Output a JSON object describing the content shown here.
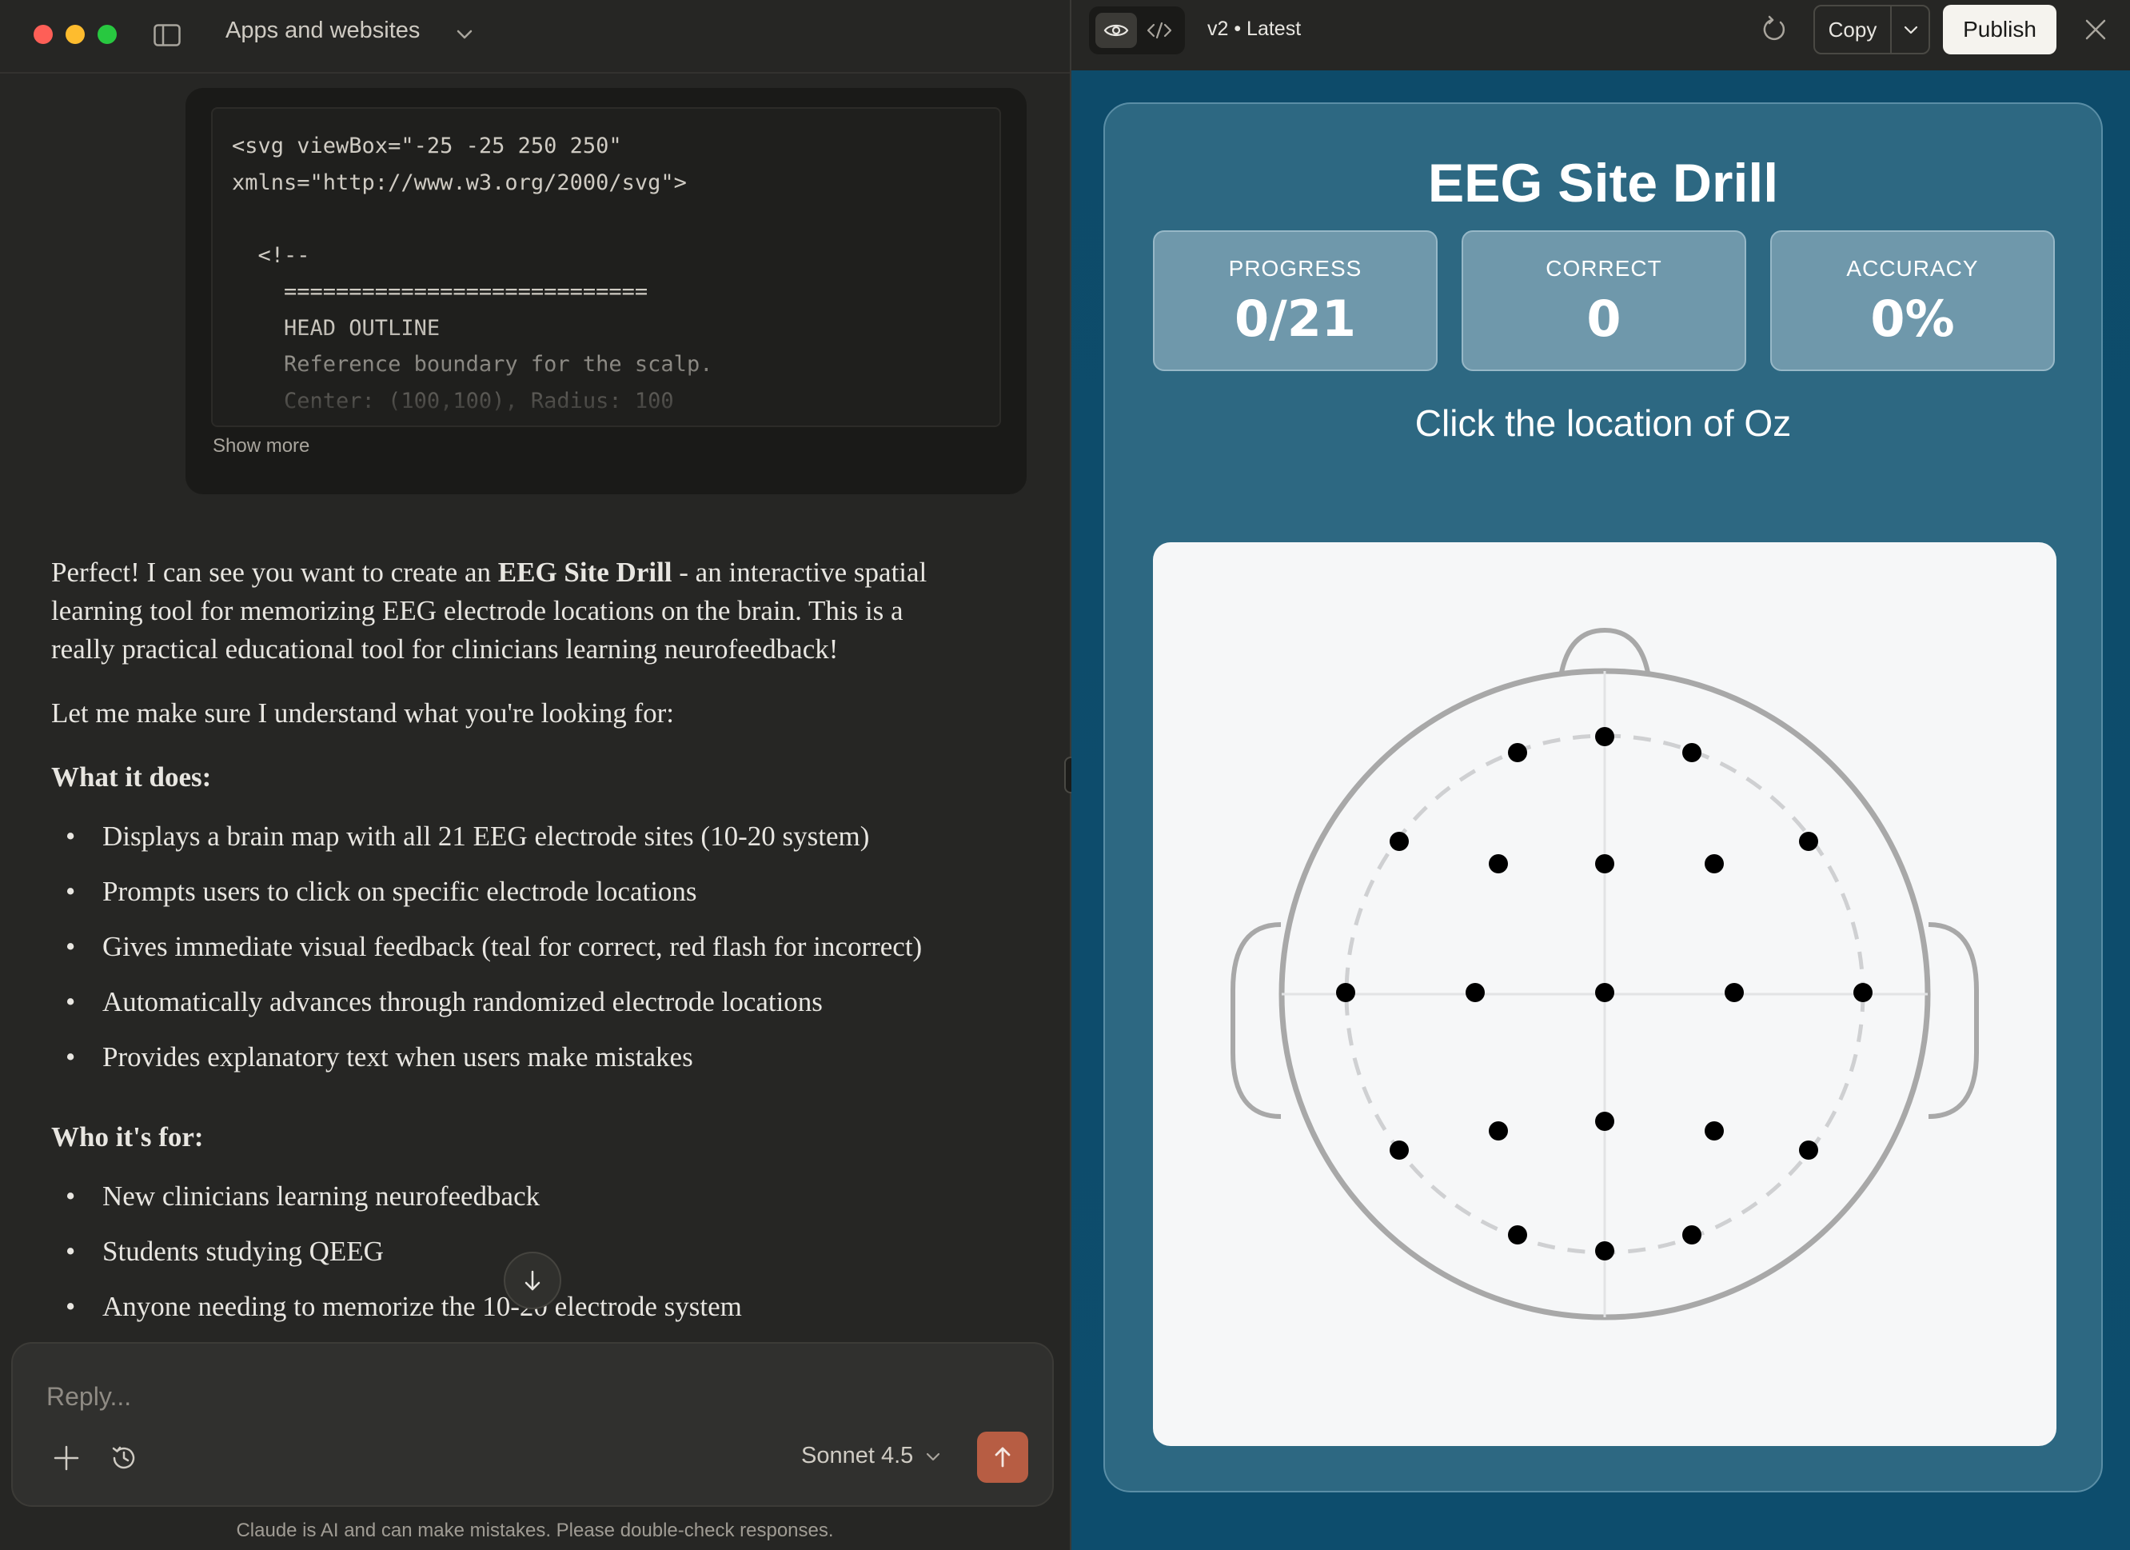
{
  "window": {
    "project_title": "Apps and websites"
  },
  "code_block": {
    "text": "<svg viewBox=\"-25 -25 250 250\"\nxmlns=\"http://www.w3.org/2000/svg\">\n\n  <!--\n    ============================\n    HEAD OUTLINE\n    Reference boundary for the scalp.\n    Center: (100,100), Radius: 100",
    "show_more_label": "Show more"
  },
  "message": {
    "intro_before": "Perfect! I can see you want to create an ",
    "intro_bold": "EEG Site Drill",
    "intro_after": " - an interactive spatial learning tool for memorizing EEG electrode locations on the brain. This is a really practical educational tool for clinicians learning neurofeedback!",
    "understand": "Let me make sure I understand what you're looking for:",
    "what_heading": "What it does:",
    "what_items": [
      "Displays a brain map with all 21 EEG electrode sites (10-20 system)",
      "Prompts users to click on specific electrode locations",
      "Gives immediate visual feedback (teal for correct, red flash for incorrect)",
      "Automatically advances through randomized electrode locations",
      "Provides explanatory text when users make mistakes"
    ],
    "who_heading": "Who it's for:",
    "who_items": [
      "New clinicians learning neurofeedback",
      "Students studying QEEG",
      "Anyone needing to memorize the 10-20 electrode system"
    ]
  },
  "composer": {
    "placeholder": "Reply...",
    "model": "Sonnet 4.5",
    "disclaimer": "Claude is AI and can make mistakes. Please double-check responses."
  },
  "artifact": {
    "version": "v2 • Latest",
    "copy_label": "Copy",
    "publish_label": "Publish"
  },
  "app": {
    "title": "EEG Site Drill",
    "stats": {
      "progress_label": "PROGRESS",
      "progress_value": "0/21",
      "correct_label": "CORRECT",
      "correct_value": "0",
      "accuracy_label": "ACCURACY",
      "accuracy_value": "0%"
    },
    "prompt": "Click the location of Oz",
    "electrode_count": 21,
    "colors": {
      "electrode": "#000000",
      "head_outline": "#a8a8a8",
      "card_bg": "#2d6882",
      "send_button": "#b75d43"
    }
  }
}
